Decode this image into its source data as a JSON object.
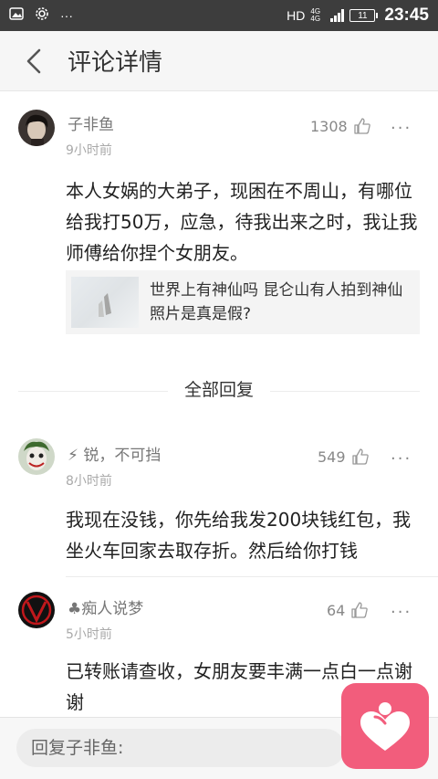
{
  "status_bar": {
    "hd": "HD",
    "network": "4G 4G",
    "battery": "11",
    "time": "23:45"
  },
  "nav": {
    "title": "评论详情"
  },
  "main_comment": {
    "username": "子非鱼",
    "time": "9小时前",
    "likes": "1308",
    "content": "本人女娲的大弟子，现困在不周山，有哪位给我打50万，应急，待我出来之时，我让我师傅给你捏个女朋友。",
    "article_title": "世界上有神仙吗 昆仑山有人拍到神仙照片是真是假?"
  },
  "section_title": "全部回复",
  "replies": [
    {
      "username": "⚡ 锐，不可挡",
      "time": "8小时前",
      "likes": "549",
      "content": "我现在没钱，你先给我发200块钱红包，我坐火车回家去取存折。然后给你打钱"
    },
    {
      "username": "♣痴人说梦",
      "time": "5小时前",
      "likes": "64",
      "content": "已转账请查收，女朋友要丰满一点白一点谢谢"
    }
  ],
  "more_label": "···",
  "reply_bar": {
    "placeholder": "回复子非鱼:"
  },
  "colors": {
    "status_bar": "#3d3d3d",
    "nav_bg": "#f6f6f6",
    "accent_pink": "#f25d7c"
  }
}
